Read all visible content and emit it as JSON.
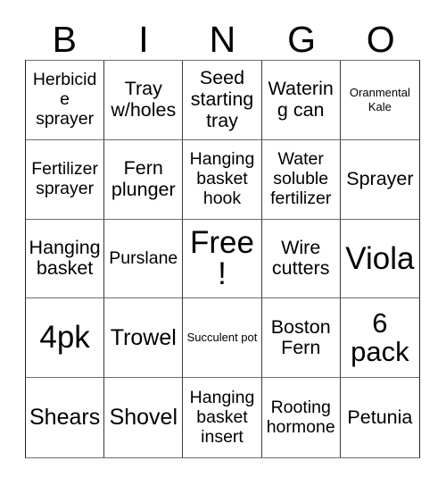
{
  "card": {
    "header_letters": [
      "B",
      "I",
      "N",
      "G",
      "O"
    ],
    "grid_size": "5x5",
    "free_space_label": "Free!",
    "colors": {
      "background": "#ffffff",
      "text": "#000000",
      "border": "#3a3a3a"
    },
    "rows": [
      [
        {
          "text": "Herbicide sprayer",
          "size": "sm"
        },
        {
          "text": "Tray w/holes",
          "size": "md"
        },
        {
          "text": "Seed starting tray",
          "size": "md"
        },
        {
          "text": "Watering can",
          "size": "md"
        },
        {
          "text": "Oranmental Kale",
          "size": "xs"
        }
      ],
      [
        {
          "text": "Fertilizer sprayer",
          "size": "sm"
        },
        {
          "text": "Fern plunger",
          "size": "md"
        },
        {
          "text": "Hanging basket hook",
          "size": "sm"
        },
        {
          "text": "Water soluble fertilizer",
          "size": "sm"
        },
        {
          "text": "Sprayer",
          "size": "md"
        }
      ],
      [
        {
          "text": "Hanging basket",
          "size": "md"
        },
        {
          "text": "Purslane",
          "size": "sm"
        },
        {
          "text": "Free!",
          "size": "xxl"
        },
        {
          "text": "Wire cutters",
          "size": "md"
        },
        {
          "text": "Viola",
          "size": "xxl"
        }
      ],
      [
        {
          "text": "4pk",
          "size": "xxl"
        },
        {
          "text": "Trowel",
          "size": "lg"
        },
        {
          "text": "Succulent pot",
          "size": "xs"
        },
        {
          "text": "Boston Fern",
          "size": "md"
        },
        {
          "text": "6 pack",
          "size": "xl"
        }
      ],
      [
        {
          "text": "Shears",
          "size": "lg"
        },
        {
          "text": "Shovel",
          "size": "lg"
        },
        {
          "text": "Hanging basket insert",
          "size": "sm"
        },
        {
          "text": "Rooting hormone",
          "size": "sm"
        },
        {
          "text": "Petunia",
          "size": "md"
        }
      ]
    ]
  }
}
